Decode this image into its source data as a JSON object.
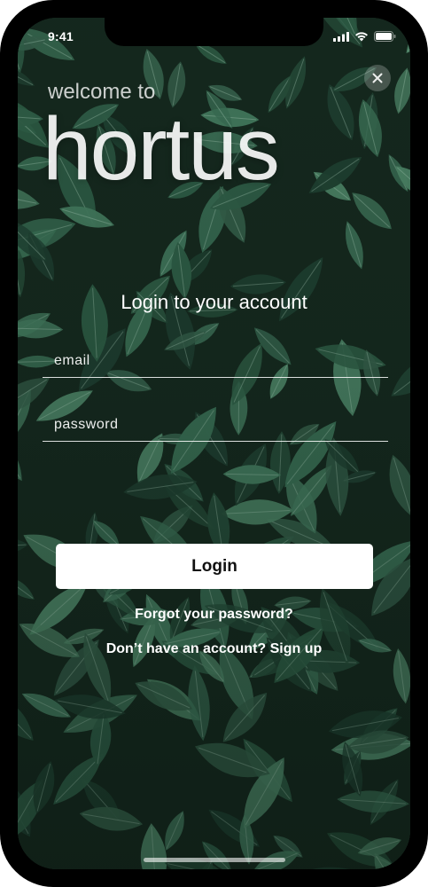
{
  "status_bar": {
    "time": "9:41",
    "icons": [
      "cellular-signal-icon",
      "wifi-icon",
      "battery-icon"
    ]
  },
  "header": {
    "welcome": "welcome to",
    "brand": "hortus",
    "close_icon": "close-icon"
  },
  "form": {
    "title": "Login to your account",
    "email_placeholder": "email",
    "password_placeholder": "password",
    "login_label": "Login",
    "forgot_label": "Forgot your password?",
    "signup_prompt": "Don’t have an account?",
    "signup_label": "Sign up"
  },
  "colors": {
    "background_leaves": "#2f5e47",
    "button_bg": "#ffffff",
    "text": "#ffffff"
  }
}
